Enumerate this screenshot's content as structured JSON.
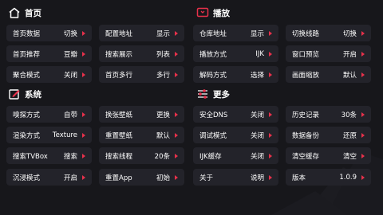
{
  "accent_color": "#e8314b",
  "sections": {
    "home": {
      "title": "首页",
      "icon": "home-icon"
    },
    "player": {
      "title": "播放",
      "icon": "player-icon"
    },
    "system": {
      "title": "系统",
      "icon": "edit-icon"
    },
    "more": {
      "title": "更多",
      "icon": "sliders-icon"
    }
  },
  "items": {
    "home_data": {
      "label": "首页数据",
      "value": "切换"
    },
    "config_url": {
      "label": "配置地址",
      "value": "显示"
    },
    "home_rec": {
      "label": "首页推荐",
      "value": "豆瓣"
    },
    "search_display": {
      "label": "搜索展示",
      "value": "列表"
    },
    "aggregate_mode": {
      "label": "聚合模式",
      "value": "关闭"
    },
    "home_rows": {
      "label": "首页多行",
      "value": "多行"
    },
    "repo_url": {
      "label": "仓库地址",
      "value": "显示"
    },
    "switch_line": {
      "label": "切换线路",
      "value": "切换"
    },
    "play_mode": {
      "label": "播放方式",
      "value": "IJK"
    },
    "window_preview": {
      "label": "窗口预览",
      "value": "开启"
    },
    "decode_mode": {
      "label": "解码方式",
      "value": "选择"
    },
    "screen_scale": {
      "label": "画面缩放",
      "value": "默认"
    },
    "sniff_mode": {
      "label": "嗅探方式",
      "value": "自带"
    },
    "change_wallpaper": {
      "label": "换张壁纸",
      "value": "更换"
    },
    "render_mode": {
      "label": "渲染方式",
      "value": "Texture"
    },
    "reset_wallpaper": {
      "label": "重置壁纸",
      "value": "默认"
    },
    "search_tvbox": {
      "label": "搜索TVBox",
      "value": "搜索"
    },
    "search_threads": {
      "label": "搜索线程",
      "value": "20条"
    },
    "immersive_mode": {
      "label": "沉浸模式",
      "value": "开启"
    },
    "reset_app": {
      "label": "重置App",
      "value": "初始"
    },
    "safe_dns": {
      "label": "安全DNS",
      "value": "关闭"
    },
    "history": {
      "label": "历史记录",
      "value": "30条"
    },
    "debug_mode": {
      "label": "调试模式",
      "value": "关闭"
    },
    "data_backup": {
      "label": "数据备份",
      "value": "还原"
    },
    "ijk_cache": {
      "label": "IJK缓存",
      "value": "关闭"
    },
    "clear_cache": {
      "label": "清空缓存",
      "value": "清空"
    },
    "about": {
      "label": "关于",
      "value": "说明"
    },
    "version": {
      "label": "版本",
      "value": "1.0.9"
    }
  }
}
